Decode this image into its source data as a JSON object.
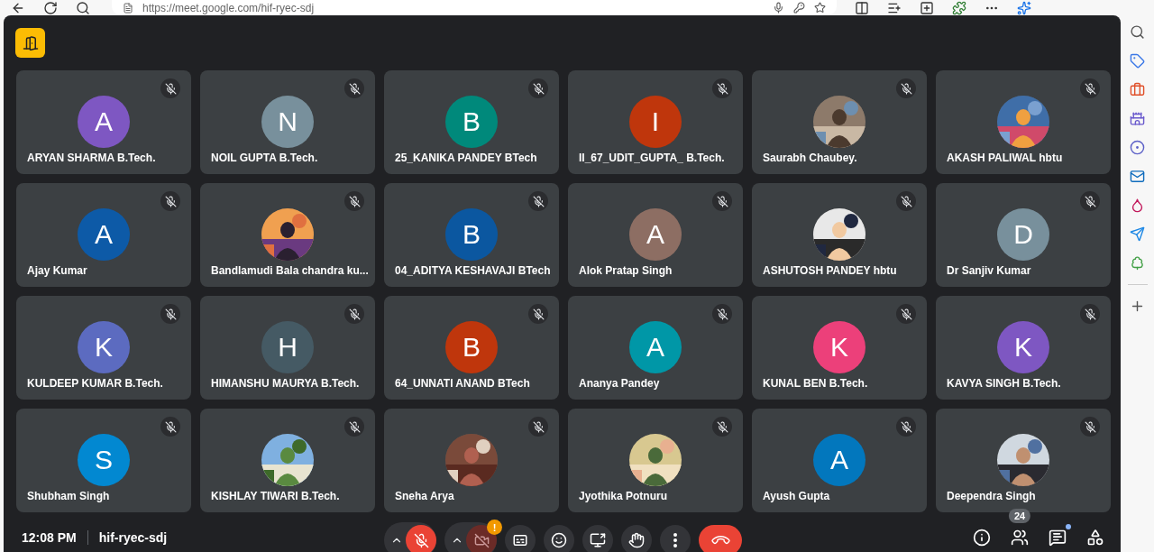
{
  "browser": {
    "url": "https://meet.google.com/hif-ryec-sdj"
  },
  "tiles": [
    {
      "name": "ARYAN SHARMA B.Tech.",
      "kind": "letter",
      "initial": "A",
      "color": "#7e57c2",
      "muted": true
    },
    {
      "name": "NOIL GUPTA B.Tech.",
      "kind": "letter",
      "initial": "N",
      "color": "#78909c",
      "muted": true
    },
    {
      "name": "25_KANIKA PANDEY BTech",
      "kind": "letter",
      "initial": "B",
      "color": "#00897b",
      "muted": true
    },
    {
      "name": "II_67_UDIT_GUPTA_ B.Tech.",
      "kind": "letter",
      "initial": "I",
      "color": "#bf360c",
      "muted": true
    },
    {
      "name": "Saurabh Chaubey.",
      "kind": "picture",
      "muted": true
    },
    {
      "name": "AKASH PALIWAL hbtu",
      "kind": "picture",
      "muted": true
    },
    {
      "name": "Ajay Kumar",
      "kind": "letter",
      "initial": "A",
      "color": "#0d5aa7",
      "muted": true
    },
    {
      "name": "Bandlamudi Bala chandra ku...",
      "kind": "picture",
      "muted": true
    },
    {
      "name": "04_ADITYA KESHAVAJI BTech",
      "kind": "letter",
      "initial": "B",
      "color": "#0b57a0",
      "muted": true
    },
    {
      "name": "Alok Pratap Singh",
      "kind": "letter",
      "initial": "A",
      "color": "#8d6e63",
      "muted": true
    },
    {
      "name": "ASHUTOSH PANDEY hbtu",
      "kind": "picture",
      "muted": true
    },
    {
      "name": "Dr Sanjiv Kumar",
      "kind": "letter",
      "initial": "D",
      "color": "#78909c",
      "muted": true
    },
    {
      "name": "KULDEEP KUMAR B.Tech.",
      "kind": "letter",
      "initial": "K",
      "color": "#5c6bc0",
      "muted": true
    },
    {
      "name": "HIMANSHU MAURYA B.Tech.",
      "kind": "letter",
      "initial": "H",
      "color": "#455a64",
      "muted": true
    },
    {
      "name": "64_UNNATI ANAND BTech",
      "kind": "letter",
      "initial": "B",
      "color": "#bf360c",
      "muted": true
    },
    {
      "name": "Ananya Pandey",
      "kind": "letter",
      "initial": "A",
      "color": "#0097a7",
      "muted": true
    },
    {
      "name": "KUNAL BEN B.Tech.",
      "kind": "letter",
      "initial": "K",
      "color": "#ec407a",
      "muted": true
    },
    {
      "name": "KAVYA SINGH B.Tech.",
      "kind": "letter",
      "initial": "K",
      "color": "#7e57c2",
      "muted": true
    },
    {
      "name": "Shubham Singh",
      "kind": "letter",
      "initial": "S",
      "color": "#0288d1",
      "muted": true
    },
    {
      "name": "KISHLAY TIWARI B.Tech.",
      "kind": "picture",
      "muted": true
    },
    {
      "name": "Sneha Arya",
      "kind": "picture",
      "muted": true
    },
    {
      "name": "Jyothika Potnuru",
      "kind": "picture",
      "muted": true
    },
    {
      "name": "Ayush Gupta",
      "kind": "letter",
      "initial": "A",
      "color": "#0277bd",
      "muted": true
    },
    {
      "name": "Deependra Singh",
      "kind": "picture",
      "muted": true
    }
  ],
  "bottom_bar": {
    "time": "12:08 PM",
    "meeting_code": "hif-ryec-sdj",
    "mic_on": false,
    "camera_on": false,
    "camera_alert": "!",
    "participants_count": "24",
    "chat_unread": true
  }
}
